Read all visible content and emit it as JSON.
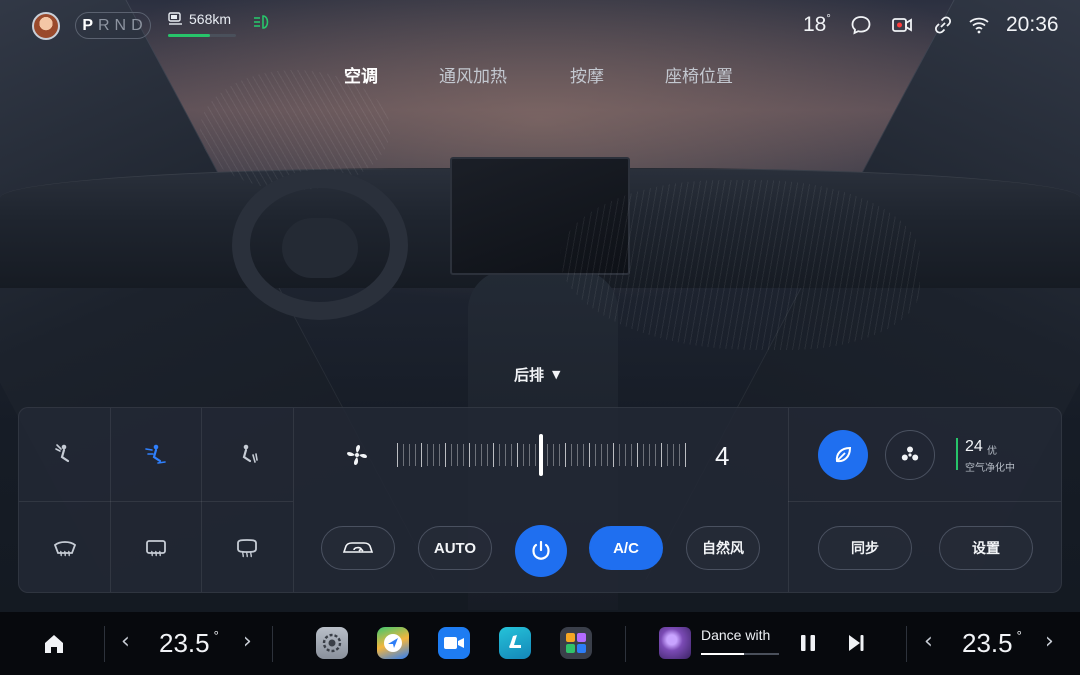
{
  "status": {
    "gears": [
      "P",
      "R",
      "N",
      "D"
    ],
    "active_gear": "P",
    "range": "568km",
    "range_fraction": 0.62,
    "outside_temp": "18",
    "outside_temp_unit": "°",
    "time": "20:36"
  },
  "tabs": [
    {
      "label": "空调",
      "active": true
    },
    {
      "label": "通风加热",
      "active": false
    },
    {
      "label": "按摩",
      "active": false
    },
    {
      "label": "座椅位置",
      "active": false
    }
  ],
  "zone_selector": {
    "label": "后排",
    "arrow": "▼"
  },
  "climate": {
    "fan_level": "4",
    "fan_level_fraction": 0.5,
    "buttons": {
      "recirculation_icon": "car-recirculation-icon",
      "auto": "AUTO",
      "power_icon": "power-icon",
      "ac": "A/C",
      "natural_wind": "自然风"
    },
    "airflow_modes": [
      "face-airflow-icon",
      "face-feet-airflow-icon",
      "feet-airflow-icon"
    ],
    "active_airflow_mode": 1,
    "defrost_modes": [
      "front-defrost-icon",
      "rear-defrost-icon",
      "mirror-defrost-icon"
    ],
    "air_quality": {
      "value": "24",
      "grade": "优",
      "status": "空气净化中"
    },
    "sync": "同步",
    "settings": "设置",
    "colors": {
      "accent": "#1f6ff0",
      "good": "#27c46a"
    }
  },
  "dock": {
    "left_temp": "23.5",
    "right_temp": "23.5",
    "temp_unit": "°",
    "apps": [
      "settings-app-icon",
      "navigation-app-icon",
      "video-call-app-icon",
      "seat-app-icon",
      "app-grid-icon"
    ],
    "media": {
      "title": "Dance with",
      "progress": 0.55
    }
  }
}
